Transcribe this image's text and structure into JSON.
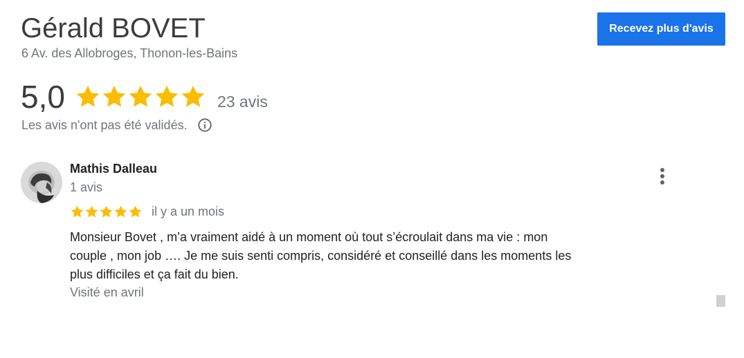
{
  "header": {
    "title": "Gérald BOVET",
    "address": "6 Av. des Allobroges, Thonon-les-Bains",
    "cta_label": "Recevez plus d'avis"
  },
  "summary": {
    "rating": "5,0",
    "stars": 5,
    "review_count": "23 avis",
    "disclaimer": "Les avis n'ont pas été validés."
  },
  "review": {
    "author": "Mathis Dalleau",
    "author_reviews": "1 avis",
    "stars": 5,
    "date": "il y a un mois",
    "text": "Monsieur Bovet , m’a vraiment aidé à un moment où tout s’écroulait dans ma vie : mon couple , mon job …. Je me suis senti compris, considéré et conseillé dans les moments les plus difficiles et ça fait du bien.",
    "visited": "Visité en avril"
  },
  "colors": {
    "star": "#fbbc04",
    "button": "#1a73e8",
    "text_primary": "#202124",
    "text_secondary": "#70757a"
  },
  "icons": {
    "star": "star-icon",
    "info": "info-icon",
    "more": "more-vert-icon",
    "avatar": "avatar-photo"
  }
}
